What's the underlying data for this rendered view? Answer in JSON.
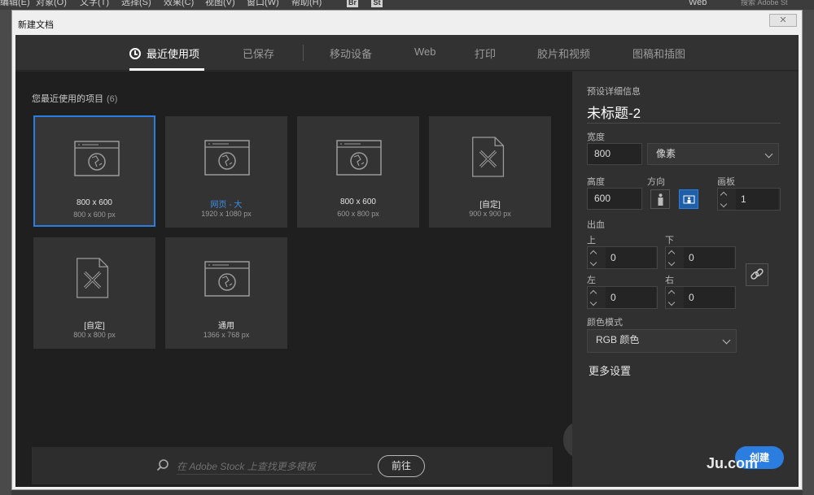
{
  "app_menu": {
    "items": [
      "编辑(E)",
      "对象(O)",
      "文字(T)",
      "选择(S)",
      "效果(C)",
      "视图(V)",
      "窗口(W)",
      "帮助(H)"
    ],
    "bridge_label": "Br",
    "stock_label": "St",
    "workspace": "Web",
    "search_placeholder": "搜索 Adobe St"
  },
  "dialog": {
    "title": "新建文档",
    "close_label": "✕",
    "tabs": [
      {
        "label": "最近使用项",
        "active": true
      },
      {
        "label": "已保存"
      },
      {
        "label": "移动设备"
      },
      {
        "label": "Web"
      },
      {
        "label": "打印"
      },
      {
        "label": "胶片和视频"
      },
      {
        "label": "图稿和插图"
      }
    ]
  },
  "recent": {
    "title": "您最近使用的项目",
    "count": "(6)",
    "cards": [
      {
        "name": "800 x 600",
        "dim": "800 x 600 px",
        "icon": "web-icon",
        "selected": true
      },
      {
        "name": "网页 - 大",
        "dim": "1920 x 1080 px",
        "icon": "web-icon",
        "link": true
      },
      {
        "name": "800 x 600",
        "dim": "600 x 800 px",
        "icon": "web-icon"
      },
      {
        "name": "[自定]",
        "dim": "900 x 900 px",
        "icon": "document-icon"
      },
      {
        "name": "[自定]",
        "dim": "800 x 800 px",
        "icon": "document-icon"
      },
      {
        "name": "通用",
        "dim": "1366 x 768 px",
        "icon": "web-icon"
      }
    ]
  },
  "stock": {
    "placeholder": "在 Adobe Stock 上查找更多模板",
    "go_label": "前往"
  },
  "details": {
    "header": "预设详细信息",
    "doc_name": "未标题-2",
    "width_label": "宽度",
    "width_value": "800",
    "unit": "像素",
    "height_label": "高度",
    "height_value": "600",
    "orientation_label": "方向",
    "artboards_label": "画板",
    "artboards_value": "1",
    "bleed_label": "出血",
    "top_label": "上",
    "top_value": "0",
    "bottom_label": "下",
    "bottom_value": "0",
    "left_label": "左",
    "left_value": "0",
    "right_label": "右",
    "right_value": "0",
    "color_mode_label": "颜色模式",
    "color_mode_value": "RGB 颜色",
    "more_settings": "更多设置",
    "create_label": "创建"
  },
  "watermark": "Ju.com",
  "colors": {
    "accent": "#2b7de0",
    "link": "#3f8fe8"
  }
}
